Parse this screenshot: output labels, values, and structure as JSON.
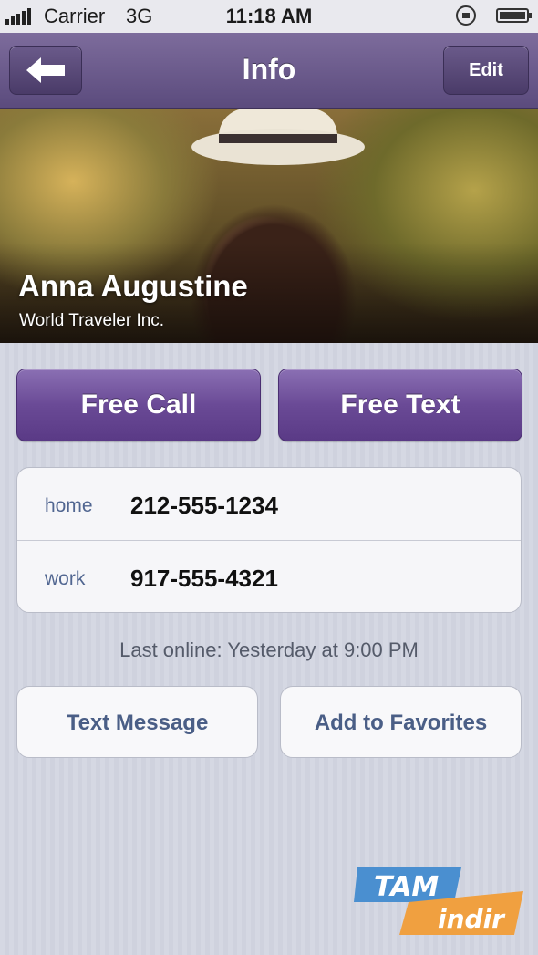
{
  "status_bar": {
    "carrier": "Carrier",
    "network": "3G",
    "time": "11:18 AM",
    "icons": [
      "signal-icon",
      "rotation-lock-icon",
      "battery-icon"
    ]
  },
  "nav": {
    "title": "Info",
    "back_icon": "back-arrow-icon",
    "edit_label": "Edit"
  },
  "contact": {
    "name": "Anna Augustine",
    "company": "World Traveler Inc."
  },
  "actions": {
    "free_call": "Free Call",
    "free_text": "Free Text"
  },
  "phones": [
    {
      "label": "home",
      "number": "212-555-1234"
    },
    {
      "label": "work",
      "number": "917-555-4321"
    }
  ],
  "last_online": "Last online: Yesterday at 9:00 PM",
  "secondary_actions": {
    "text_message": "Text Message",
    "add_to_favorites": "Add to Favorites"
  },
  "watermark": {
    "line1": "TAM",
    "line2": "indir"
  },
  "colors": {
    "accent": "#6a4a96",
    "nav_bar": "#6a5a8a",
    "label_blue": "#516691"
  }
}
